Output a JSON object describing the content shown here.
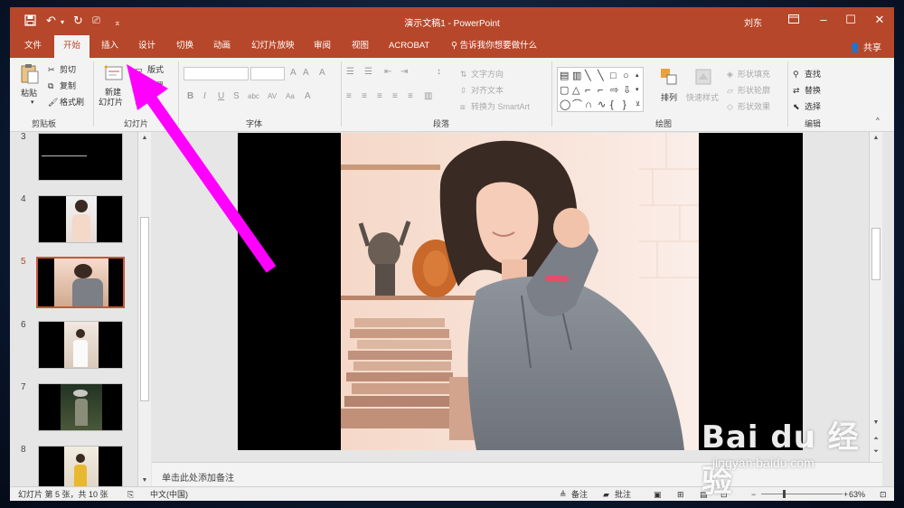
{
  "window": {
    "title": "演示文稿1 - PowerPoint",
    "user": "刘东"
  },
  "tabs": [
    "文件",
    "开始",
    "插入",
    "设计",
    "切换",
    "动画",
    "幻灯片放映",
    "审阅",
    "视图",
    "ACROBAT"
  ],
  "active_tab": "开始",
  "tell_me": "告诉我你想要做什么",
  "share": "共享",
  "ribbon": {
    "clipboard": {
      "paste": "粘贴",
      "cut": "剪切",
      "copy": "复制",
      "format_painter": "格式刷",
      "label": "剪贴板"
    },
    "slides": {
      "new_slide_1": "新建",
      "new_slide_2": "幻灯片",
      "layout": "版式",
      "reset": "重置",
      "label": "幻灯片"
    },
    "font": {
      "label": "字体"
    },
    "paragraph": {
      "text_direction": "文字方向",
      "align_text": "对齐文本",
      "smartart": "转换为 SmartArt",
      "label": "段落"
    },
    "drawing": {
      "arrange": "排列",
      "quick_styles": "快速样式",
      "shape_fill": "形状填充",
      "shape_outline": "形状轮廓",
      "shape_effects": "形状效果",
      "label": "绘图"
    },
    "editing": {
      "find": "查找",
      "replace": "替换",
      "select": "选择",
      "label": "编辑"
    }
  },
  "slides": [
    {
      "num": "3",
      "selected": false
    },
    {
      "num": "4",
      "selected": false
    },
    {
      "num": "5",
      "selected": true
    },
    {
      "num": "6",
      "selected": false
    },
    {
      "num": "7",
      "selected": false
    },
    {
      "num": "8",
      "selected": false
    }
  ],
  "notes_placeholder": "单击此处添加备注",
  "status": {
    "slide_info": "幻灯片 第 5 张，共 10 张",
    "language": "中文(中国)",
    "notes": "备注",
    "comments": "批注",
    "zoom": "63%"
  },
  "watermark": {
    "brand": "Bai du 经验",
    "url": "jingyan.baidu.com"
  },
  "colors": {
    "accent": "#b7472a",
    "annotation_arrow": "#ff00ff"
  }
}
